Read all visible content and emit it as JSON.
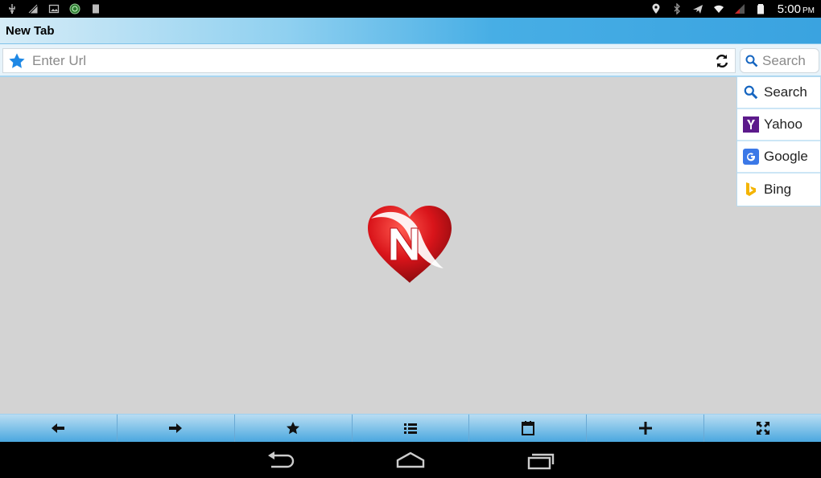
{
  "status_bar": {
    "time": "5:00",
    "ampm": "PM",
    "left_icons": [
      "usb-icon",
      "signal-broom-icon",
      "image-icon",
      "notification-badge-icon",
      "sd-card-icon"
    ],
    "right_icons": [
      "location-icon",
      "bluetooth-icon",
      "airplane-icon",
      "wifi-icon",
      "cell-signal-icon",
      "battery-icon"
    ]
  },
  "title_bar": {
    "title": "New Tab"
  },
  "url_bar": {
    "placeholder": "Enter Url",
    "value": ""
  },
  "search_box": {
    "placeholder": "Search"
  },
  "engine_menu": {
    "items": [
      {
        "label": "Search",
        "icon": "magnifier-icon"
      },
      {
        "label": "Yahoo",
        "icon": "yahoo-logo-icon"
      },
      {
        "label": "Google",
        "icon": "google-logo-icon"
      },
      {
        "label": "Bing",
        "icon": "bing-logo-icon"
      }
    ]
  },
  "toolbar": {
    "buttons": [
      "back-icon",
      "forward-icon",
      "bookmark-star-icon",
      "list-icon",
      "calendar-icon",
      "add-tab-icon",
      "fullscreen-icon"
    ]
  },
  "colors": {
    "accent_blue": "#3aa3e0",
    "background": "#d3d3d3",
    "heart_red": "#d9141a"
  }
}
